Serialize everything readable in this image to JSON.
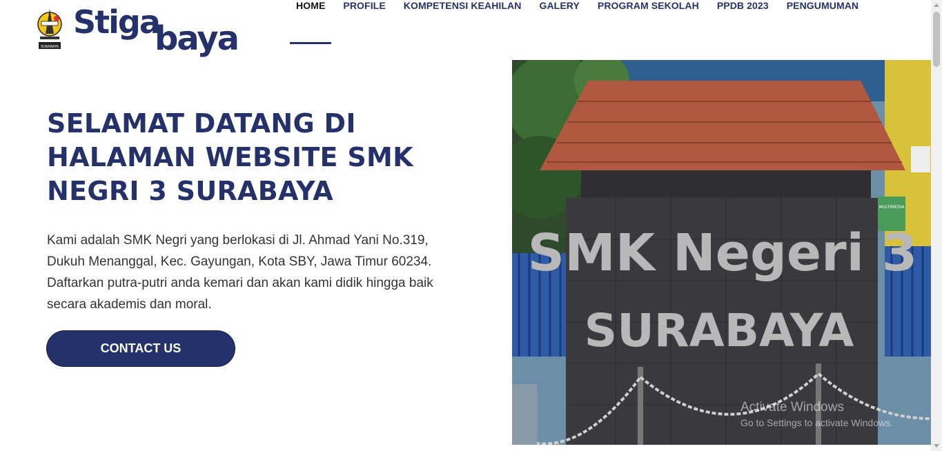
{
  "header": {
    "logo_emblem_text": "SMK NEGERI 3 SURABAYA",
    "logo_word1": "Stiga",
    "logo_word2": "baya",
    "nav": [
      {
        "label": "HOME",
        "active": true
      },
      {
        "label": "PROFILE"
      },
      {
        "label": "KOMPETENSI KEAHILAN"
      },
      {
        "label": "GALERY"
      },
      {
        "label": "PROGRAM SEKOLAH"
      },
      {
        "label": "PPDB 2023"
      },
      {
        "label": "PENGUMUMAN"
      }
    ]
  },
  "hero": {
    "title": "SELAMAT DATANG DI HALAMAN WEBSITE SMK NEGRI 3 SURABAYA",
    "description": "Kami adalah SMK Negri yang berlokasi di Jl. Ahmad Yani No.319, Dukuh Menanggal, Kec. Gayungan, Kota SBY, Jawa Timur 60234. Daftarkan putra-putri anda kemari dan akan kami didik hingga baik secara akademis dan moral.",
    "button_label": "CONTACT US"
  },
  "photo": {
    "sign_line1": "SMK Negeri 3",
    "sign_line2": "SURABAYA",
    "banner_text": "MULTIMEDIA"
  },
  "watermark": {
    "line1": "Activate Windows",
    "line2": "Go to Settings to activate Windows."
  },
  "colors": {
    "brand": "#24316b",
    "roof": "#b0583f",
    "wall": "#3a3a3e"
  }
}
